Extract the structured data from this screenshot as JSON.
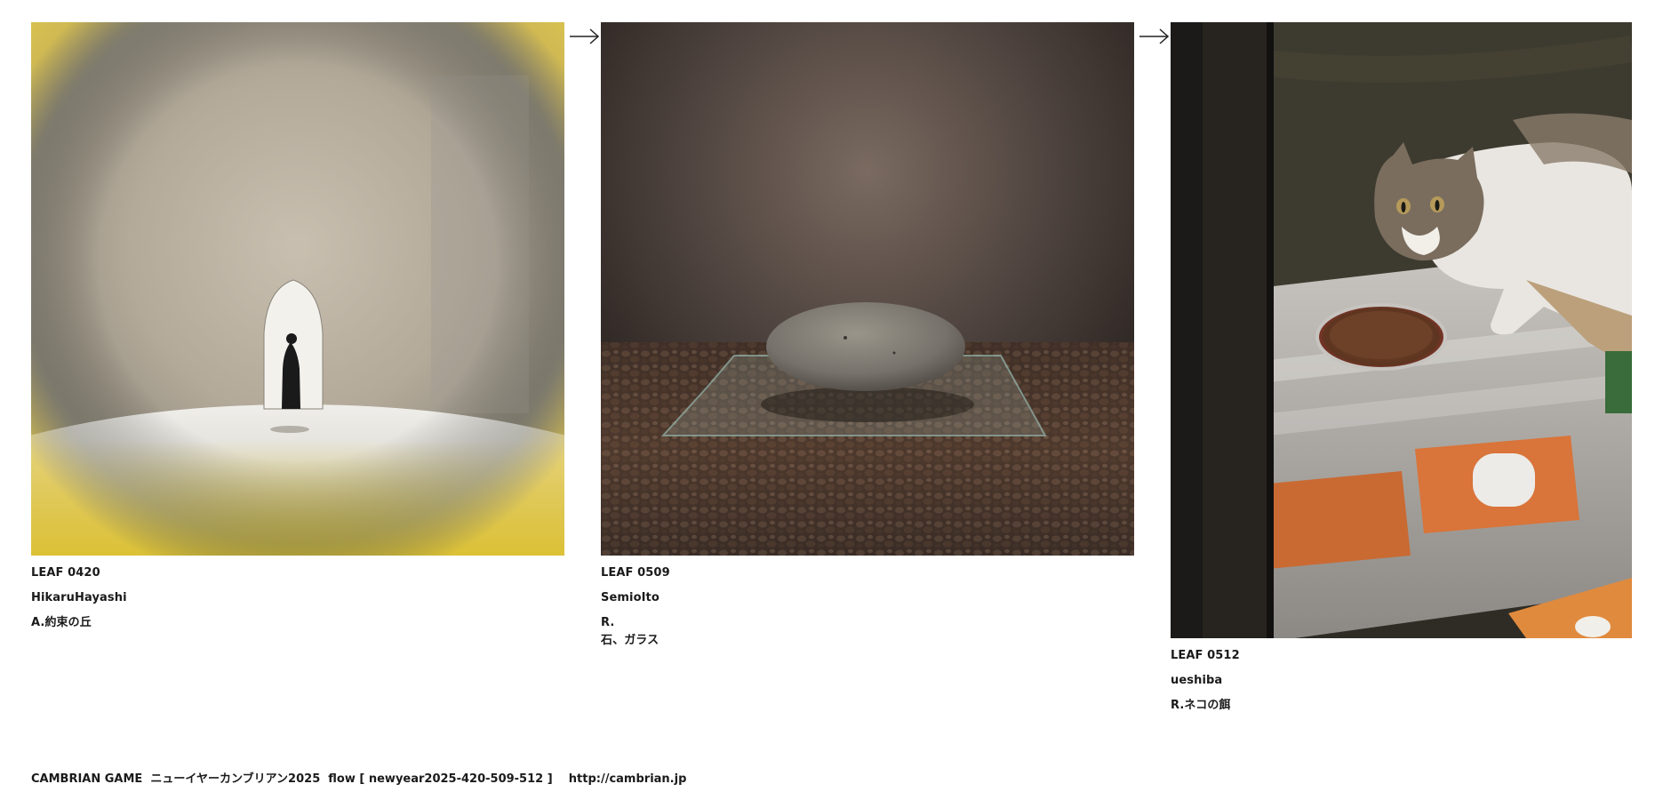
{
  "leaves": [
    {
      "id": "LEAF 0420",
      "author": "HikaruHayashi",
      "note": "A.約束の丘",
      "subject": "lens-blur-figure-on-hill"
    },
    {
      "id": "LEAF 0509",
      "author": "SemioIto",
      "note": "R.",
      "note2": "石、ガラス",
      "subject": "stone-on-glass-over-pebbles"
    },
    {
      "id": "LEAF 0512",
      "author": "ueshiba",
      "note": "R.ネコの餌",
      "subject": "cat-with-food-bowl"
    }
  ],
  "flow_arrow_icon": "right-arrow-icon",
  "footer": {
    "text": "CAMBRIAN GAME  ニューイヤーカンブリアン2025  flow [ newyear2025-420-509-512 ]    http://cambrian.jp"
  }
}
